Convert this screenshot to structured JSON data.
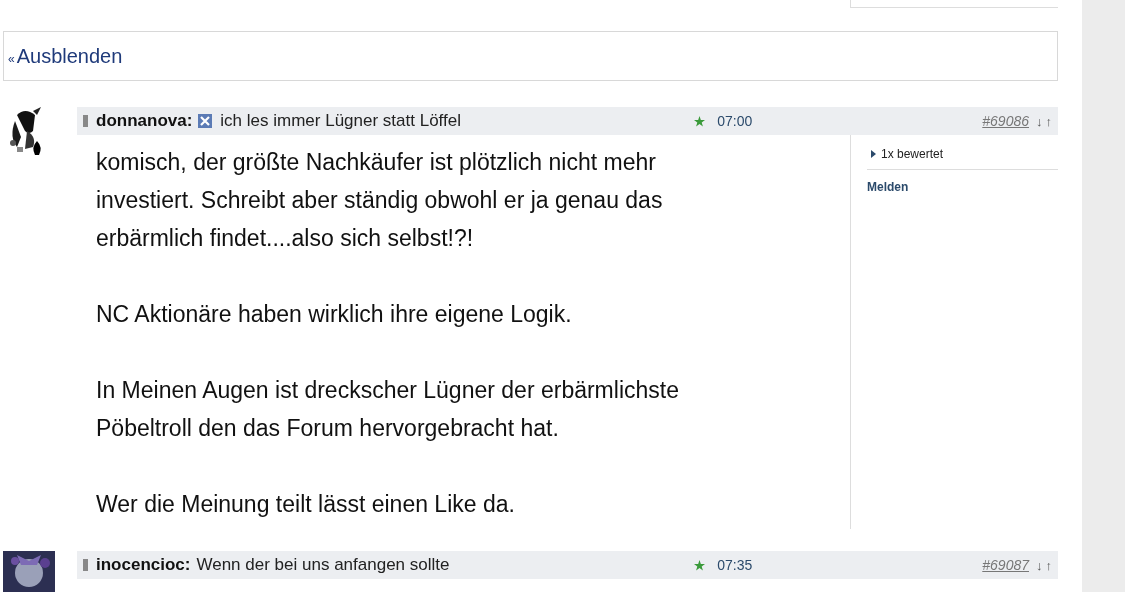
{
  "collapse_link": {
    "marker": "«",
    "label": "Ausblenden"
  },
  "posts": [
    {
      "author": "donnanova:",
      "emoji_icon": true,
      "subject": "ich les immer Lügner statt Löffel",
      "time": "07:00",
      "post_number": "#69086",
      "nav_down": "↓",
      "nav_up": "↑",
      "body": [
        "komisch, der größte Nachkäufer ist plötzlich nicht mehr investiert.  Schreibt aber ständig obwohl er ja genau das erbärmlich findet....also sich selbst!?!",
        "NC Aktionäre haben wirklich ihre eigene Logik.",
        "In Meinen Augen ist dreckscher Lügner der erbärmlichste Pöbeltroll den das Forum hervorgebracht hat.",
        "Wer die Meinung teilt lässt einen Like da."
      ],
      "rating": "1x bewertet",
      "report": "Melden"
    },
    {
      "author": "inocencioc:",
      "emoji_icon": false,
      "subject": "Wenn der bei uns anfangen sollte",
      "time": "07:35",
      "post_number": "#69087",
      "nav_down": "↓",
      "nav_up": "↑"
    }
  ]
}
